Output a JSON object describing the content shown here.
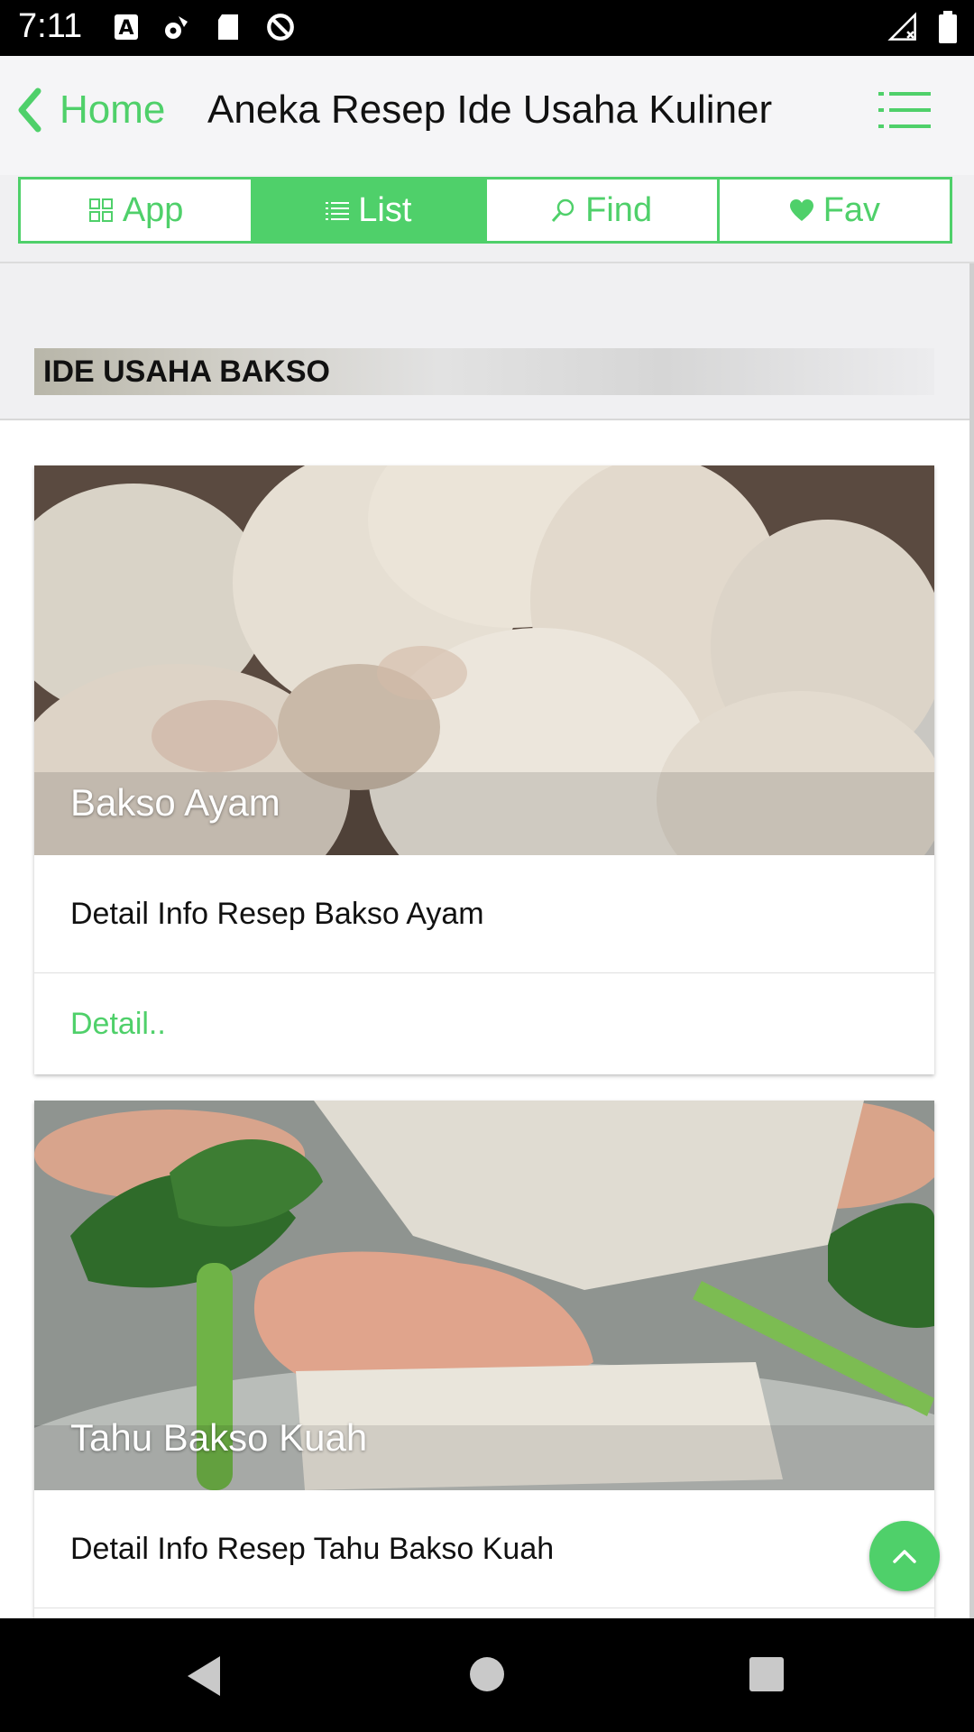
{
  "status_bar": {
    "time": "7:11",
    "icons": [
      "accessibility-a-icon",
      "settings-gear-icon",
      "sd-card-icon",
      "no-disturb-icon",
      "signal-icon",
      "battery-icon"
    ]
  },
  "header": {
    "back_label": "Home",
    "title": "Aneka Resep Ide Usaha Kuliner",
    "menu_icon": "menu-list-icon"
  },
  "tabs": [
    {
      "label": "App",
      "icon": "grid-icon",
      "active": false
    },
    {
      "label": "List",
      "icon": "list-icon",
      "active": true
    },
    {
      "label": "Find",
      "icon": "search-icon",
      "active": false
    },
    {
      "label": "Fav",
      "icon": "heart-icon",
      "active": false
    }
  ],
  "section": {
    "title": "IDE USAHA BAKSO"
  },
  "cards": [
    {
      "image_caption": "Bakso Ayam",
      "description": "Detail Info Resep Bakso Ayam",
      "action": "Detail.."
    },
    {
      "image_caption": "Tahu Bakso Kuah",
      "description": "Detail Info Resep Tahu Bakso Kuah",
      "action": ""
    }
  ],
  "colors": {
    "accent": "#4fd06a",
    "status_bar": "#000000",
    "header_bg": "#f5f5f7"
  }
}
